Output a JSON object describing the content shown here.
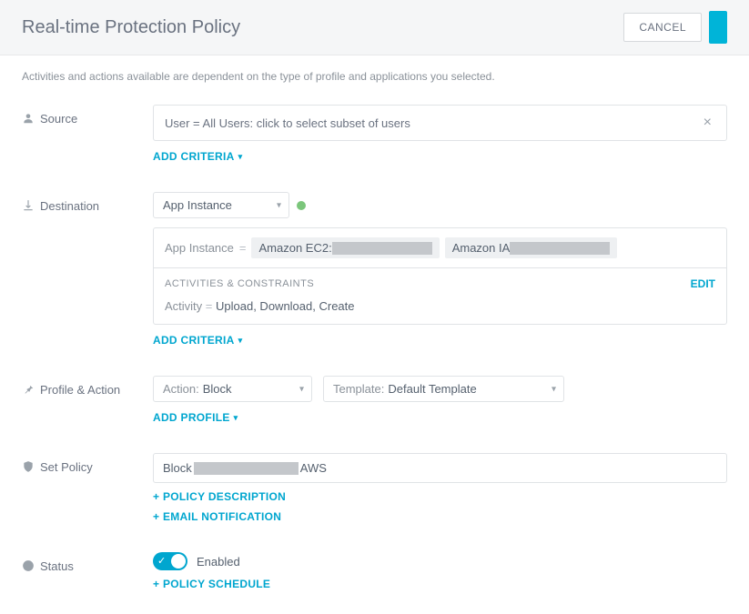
{
  "header": {
    "title": "Real-time Protection Policy",
    "cancel_label": "CANCEL"
  },
  "subnote": "Activities and actions available are dependent on the type of profile and applications you selected.",
  "sections": {
    "source": {
      "label": "Source",
      "field_text": "User = All Users: click to select subset of users",
      "add_criteria": "ADD CRITERIA"
    },
    "destination": {
      "label": "Destination",
      "selector_value": "App Instance",
      "app_instance_label": "App Instance",
      "chip1_prefix": "Amazon EC2:",
      "chip2_prefix": "Amazon IA",
      "activities_header": "ACTIVITIES & CONSTRAINTS",
      "edit_label": "EDIT",
      "activity_label": "Activity",
      "activity_value": "Upload, Download, Create",
      "add_criteria": "ADD CRITERIA"
    },
    "profile_action": {
      "label": "Profile & Action",
      "action_key": "Action:",
      "action_value": "Block",
      "template_key": "Template:",
      "template_value": "Default Template",
      "add_profile": "ADD PROFILE"
    },
    "set_policy": {
      "label": "Set Policy",
      "value_prefix": "Block",
      "value_suffix": "AWS",
      "policy_description": "+ POLICY DESCRIPTION",
      "email_notification": "+ EMAIL NOTIFICATION"
    },
    "status": {
      "label": "Status",
      "enabled_label": "Enabled",
      "policy_schedule": "+ POLICY SCHEDULE"
    }
  }
}
